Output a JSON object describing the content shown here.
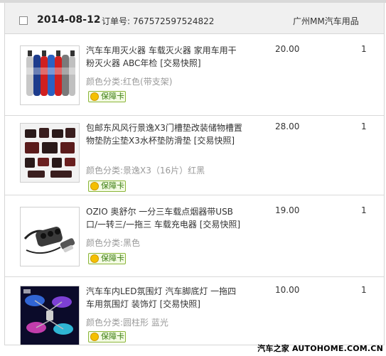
{
  "order": {
    "date": "2014-08-12",
    "order_no_label": "订单号:",
    "order_no": "767572597524822",
    "seller": "广州MM汽车用品"
  },
  "items": [
    {
      "title": "汽车车用灭火器 车载灭火器 家用车用干粉灭火器 ABC年检 [交易快照]",
      "attr_label": "颜色分类:",
      "attr_value": "红色(带支架)",
      "badge": "保障卡",
      "price": "20.00",
      "qty": "1",
      "image": "fire-extinguishers-image"
    },
    {
      "title": "包邮东风风行景逸X3门槽垫改装储物槽置物垫防尘垫X3水杯垫防滑垫 [交易快照]",
      "attr_label": "颜色分类:",
      "attr_value": "景逸X3（16片）红黑",
      "badge": "保障卡",
      "price": "28.00",
      "qty": "1",
      "image": "door-slot-mats-image"
    },
    {
      "title": "OZIO 奥舒尔 一分三车载点烟器带USB口/一转三/一拖三 车载充电器 [交易快照]",
      "attr_label": "颜色分类:",
      "attr_value": "黑色",
      "badge": "保障卡",
      "price": "19.00",
      "qty": "1",
      "image": "cigarette-splitter-image"
    },
    {
      "title": "汽车车内LED氛围灯 汽车脚底灯 一拖四车用氛围灯 装饰灯 [交易快照]",
      "attr_label": "颜色分类:",
      "attr_value": "圆柱形 蓝光",
      "badge": "保障卡",
      "price": "10.00",
      "qty": "1",
      "image": "led-lights-image"
    }
  ],
  "watermark": "汽车之家 AUTOHOME.COM.CN",
  "colors": {
    "header_bg": "#f0f0f0",
    "border": "#d6d6d6",
    "badge_green": "#3b7d10",
    "badge_yellow": "#f4c000"
  }
}
